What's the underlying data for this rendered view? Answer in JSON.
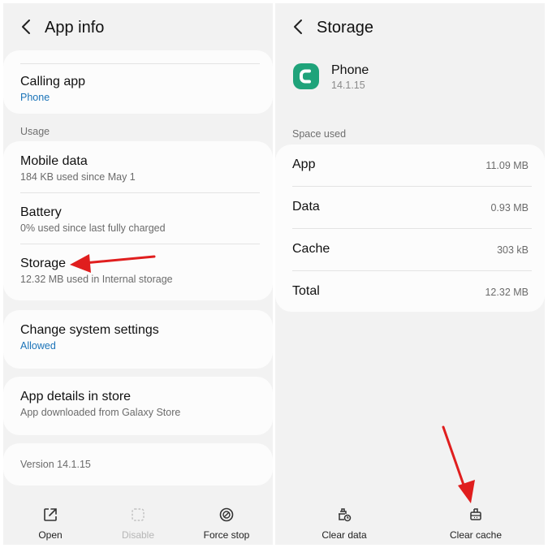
{
  "left": {
    "title": "App info",
    "calling_app": {
      "label": "Calling app",
      "value": "Phone"
    },
    "usage_header": "Usage",
    "mobile_data": {
      "label": "Mobile data",
      "sub": "184 KB used since May 1"
    },
    "battery": {
      "label": "Battery",
      "sub": "0% used since last fully charged"
    },
    "storage": {
      "label": "Storage",
      "sub": "12.32 MB used in Internal storage"
    },
    "change_settings": {
      "label": "Change system settings",
      "value": "Allowed"
    },
    "app_details": {
      "label": "App details in store",
      "sub": "App downloaded from Galaxy Store"
    },
    "version": "Version 14.1.15",
    "bottom": {
      "open": "Open",
      "disable": "Disable",
      "force_stop": "Force stop"
    }
  },
  "right": {
    "title": "Storage",
    "app_name": "Phone",
    "app_version": "14.1.15",
    "space_header": "Space used",
    "rows": [
      {
        "label": "App",
        "value": "11.09 MB"
      },
      {
        "label": "Data",
        "value": "0.93 MB"
      },
      {
        "label": "Cache",
        "value": "303 kB"
      },
      {
        "label": "Total",
        "value": "12.32 MB"
      }
    ],
    "bottom": {
      "clear_data": "Clear data",
      "clear_cache": "Clear cache"
    }
  },
  "colors": {
    "accent": "#1a73b8",
    "app_icon": "#1fa37a",
    "annotation_arrow": "#e01e1e"
  }
}
